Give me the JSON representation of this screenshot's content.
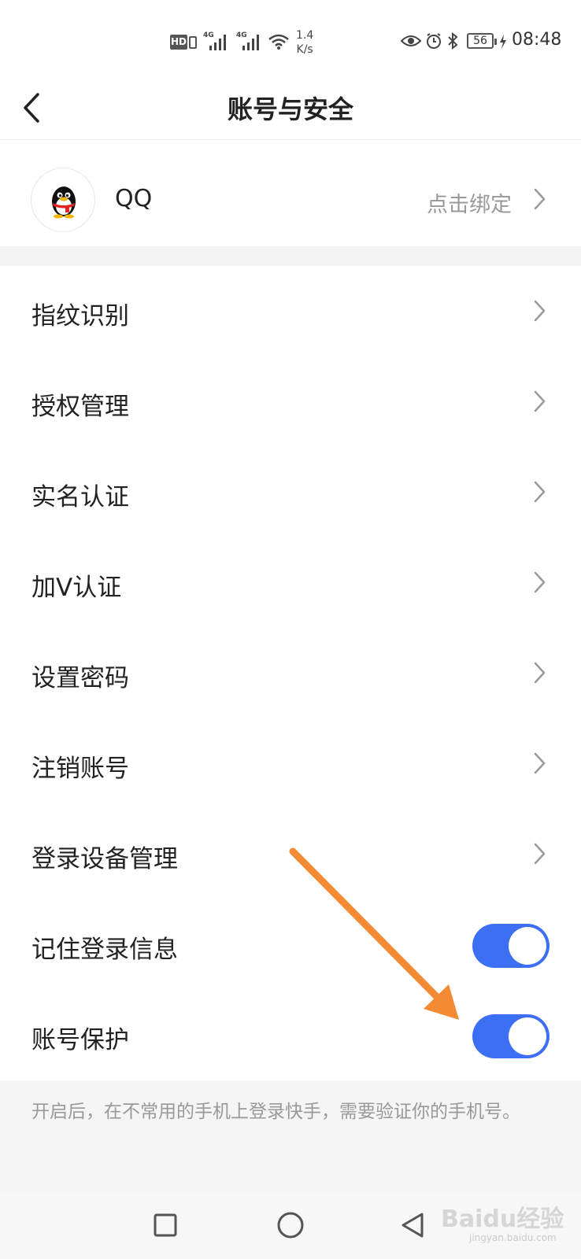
{
  "status_bar": {
    "hd_badge": "HD",
    "network_1": "4G",
    "network_2": "4G",
    "speed_value": "1.4",
    "speed_unit": "K/s",
    "battery_level": "56",
    "time": "08:48"
  },
  "header": {
    "title": "账号与安全"
  },
  "qq_binding": {
    "label": "QQ",
    "action_text": "点击绑定"
  },
  "menu": {
    "items": [
      {
        "label": "指纹识别"
      },
      {
        "label": "授权管理"
      },
      {
        "label": "实名认证"
      },
      {
        "label": "加V认证"
      },
      {
        "label": "设置密码"
      },
      {
        "label": "注销账号"
      },
      {
        "label": "登录设备管理"
      }
    ],
    "toggles": [
      {
        "label": "记住登录信息",
        "enabled": true
      },
      {
        "label": "账号保护",
        "enabled": true
      }
    ]
  },
  "footer_note": "开启后，在不常用的手机上登录快手，需要验证你的手机号。",
  "watermark": {
    "text": "Baidu经验",
    "subtext": "jingyan.baidu.com"
  },
  "colors": {
    "accent": "#3d6ff5",
    "annotation_arrow": "#f58a34",
    "muted_text": "#999999",
    "section_gap": "#f4f4f4"
  }
}
